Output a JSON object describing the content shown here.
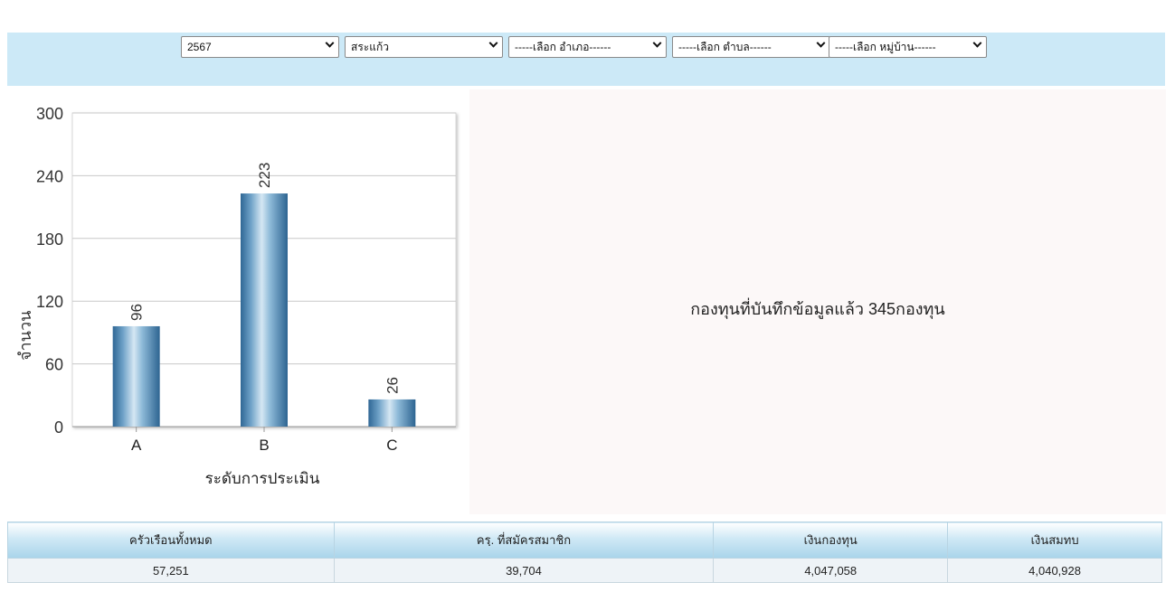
{
  "filters": {
    "year": "2567",
    "province": "สระแก้ว",
    "district": "-----เลือก อำเภอ------",
    "subdistrict": "-----เลือก ตำบล------",
    "village": "-----เลือก หมู่บ้าน------"
  },
  "chart_data": {
    "type": "bar",
    "categories": [
      "A",
      "B",
      "C"
    ],
    "values": [
      96,
      223,
      26
    ],
    "xlabel": "ระดับการประเมิน",
    "ylabel": "จำนวน",
    "ylim": [
      0,
      300
    ],
    "yticks": [
      0,
      60,
      120,
      180,
      240,
      300
    ],
    "grid": true,
    "legend": "none",
    "bar_color": "#5b8fb6"
  },
  "summary": {
    "text": "กองทุนที่บันทึกข้อมูลแล้ว 345กองทุน"
  },
  "stats_table": {
    "headers": [
      "ครัวเรือนทั้งหมด",
      "ครฺ. ที่สมัครสมาชิก",
      "เงินกองทุน",
      "เงินสมทบ"
    ],
    "values": [
      "57,251",
      "39,704",
      "4,047,058",
      "4,040,928"
    ]
  },
  "colors": {
    "filter_bar_bg": "#cce9f7",
    "right_panel_bg": "#fcf8f8",
    "header_gradient_end": "#a9d4ea"
  }
}
